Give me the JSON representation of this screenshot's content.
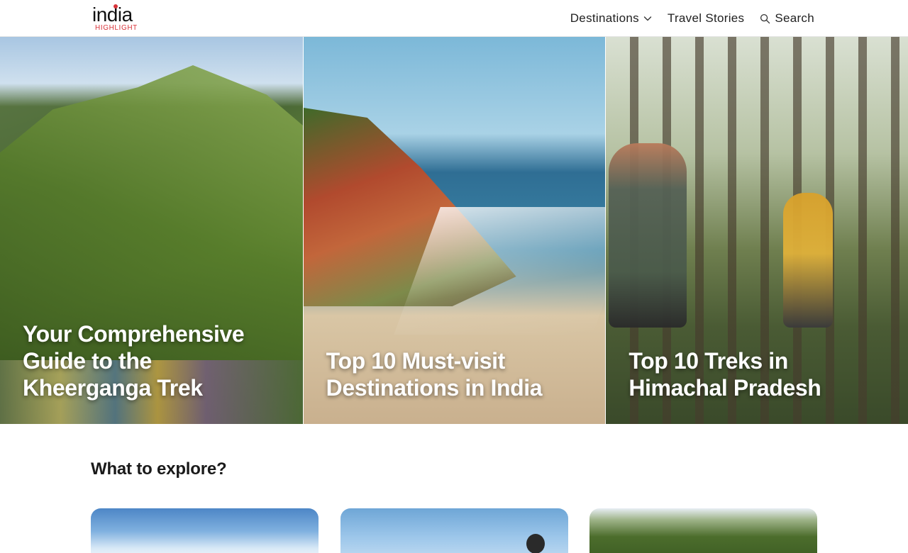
{
  "header": {
    "logo_main": "india",
    "logo_sub": "HIGHLIGHT",
    "nav": [
      {
        "label": "Destinations",
        "icon": "chevron-down-icon"
      },
      {
        "label": "Travel Stories"
      },
      {
        "label": "Search",
        "icon": "search-icon"
      }
    ]
  },
  "hero": {
    "cards": [
      {
        "title": "Your Comprehensive Guide to the Kheerganga Trek"
      },
      {
        "title": "Top 10 Must-visit Destinations in India"
      },
      {
        "title": "Top 10 Treks in Himachal Pradesh"
      }
    ]
  },
  "explore": {
    "title": "What to explore?"
  },
  "colors": {
    "brand_red": "#d8343a",
    "text_dark": "#1a1a1a"
  }
}
